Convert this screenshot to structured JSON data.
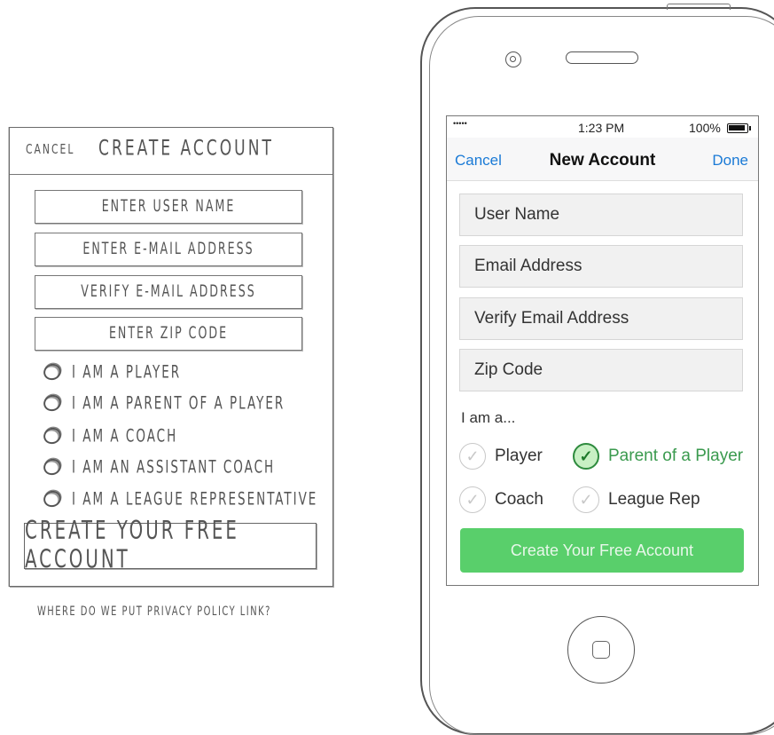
{
  "sketch": {
    "cancel": "CANCEL",
    "title": "CREATE ACCOUNT",
    "fields": [
      "ENTER USER NAME",
      "ENTER E-MAIL ADDRESS",
      "VERIFY E-MAIL ADDRESS",
      "ENTER ZIP CODE"
    ],
    "roles": [
      "I AM A PLAYER",
      "I AM A PARENT OF A PLAYER",
      "I AM A COACH",
      "I AM AN ASSISTANT COACH",
      "I AM A LEAGUE REPRESENTATIVE"
    ],
    "cta": "CREATE YOUR FREE ACCOUNT",
    "note": "WHERE DO WE PUT PRIVACY POLICY LINK?"
  },
  "phone": {
    "status": {
      "signal": "•••••",
      "time": "1:23 PM",
      "battery": "100%"
    },
    "nav": {
      "cancel": "Cancel",
      "title": "New Account",
      "done": "Done"
    },
    "fields": [
      "User Name",
      "Email Address",
      "Verify Email Address",
      "Zip Code"
    ],
    "iam_label": "I am a...",
    "options": [
      {
        "label": "Player",
        "selected": false
      },
      {
        "label": "Parent of a Player",
        "selected": true
      },
      {
        "label": "Coach",
        "selected": false
      },
      {
        "label": "League Rep",
        "selected": false
      }
    ],
    "check_glyph": "✓",
    "cta": "Create Your Free Account",
    "colors": {
      "accent": "#1a7ad6",
      "success": "#59cf6b",
      "selected_text": "#3a9a4e"
    }
  }
}
